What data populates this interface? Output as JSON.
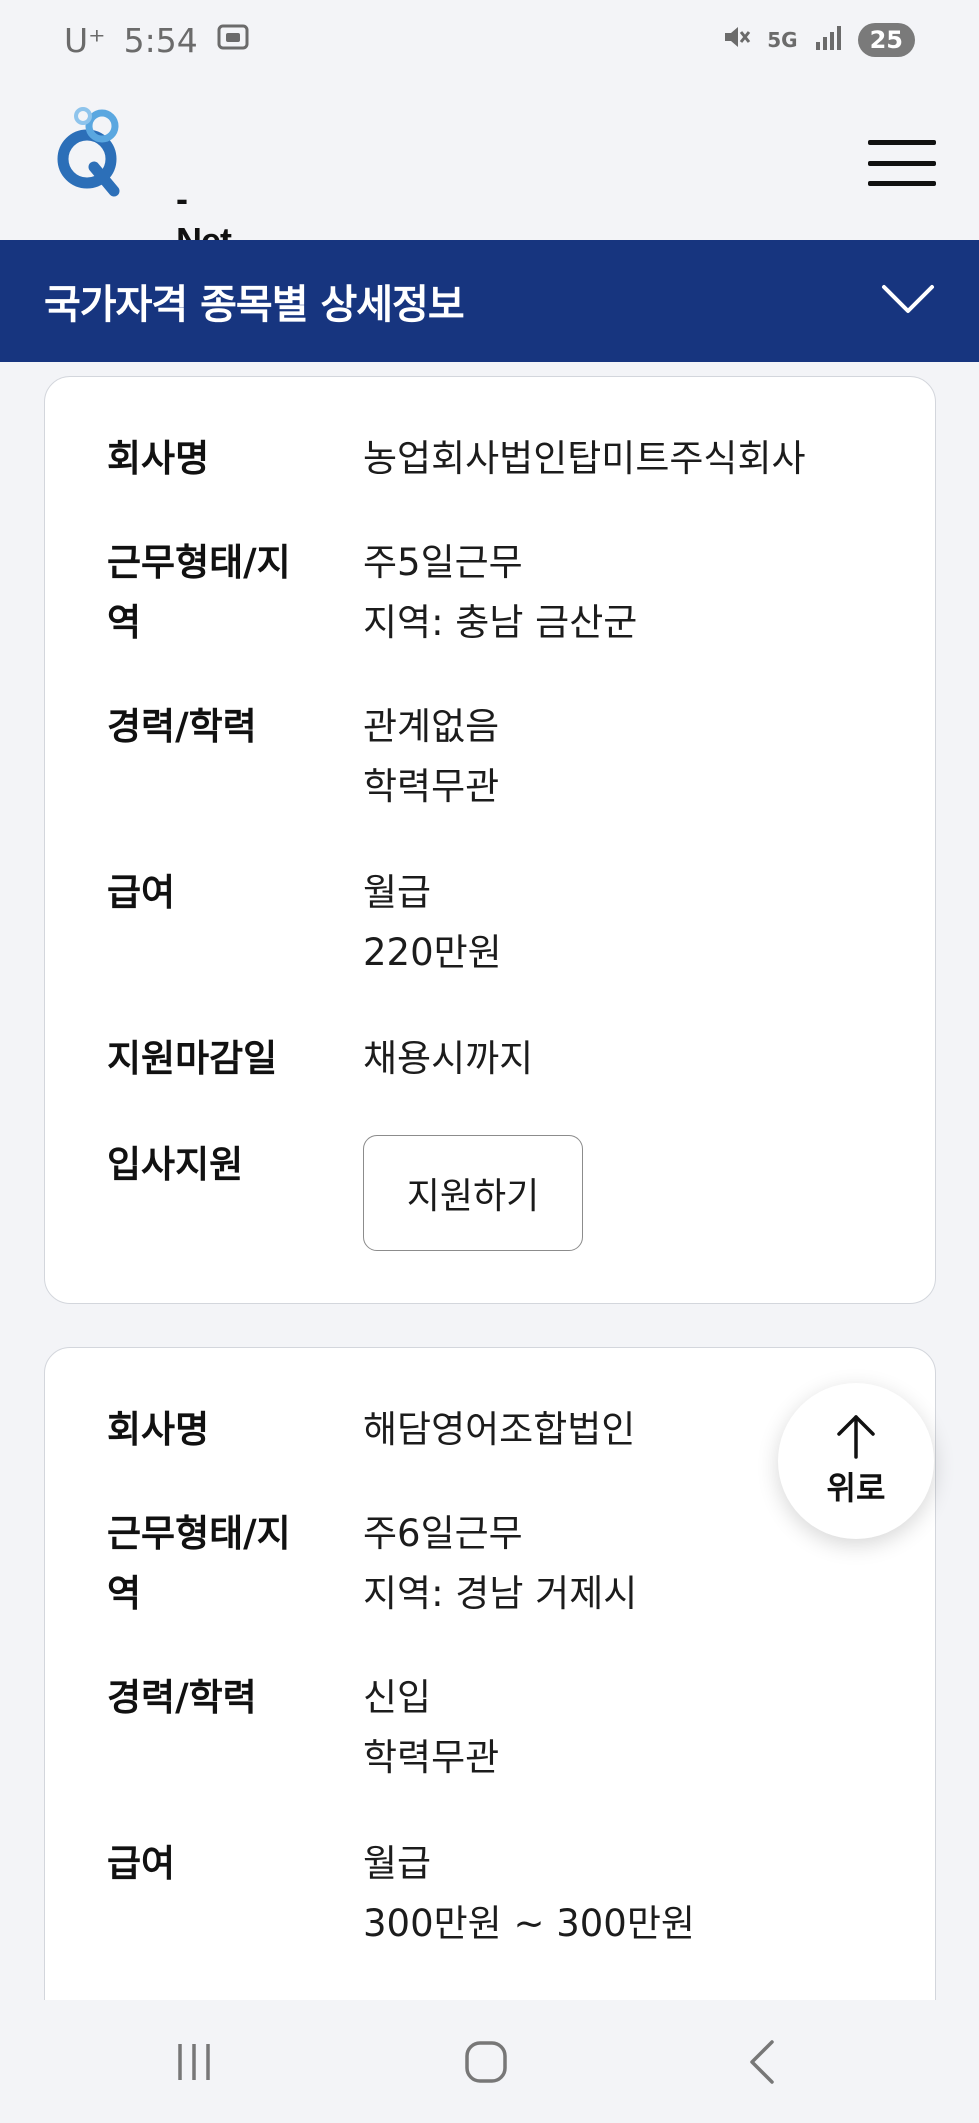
{
  "status_bar": {
    "carrier": "U⁺",
    "time": "5:54",
    "network": "5G",
    "battery": "25"
  },
  "header": {
    "logo_text": "- Net"
  },
  "title_bar": {
    "title": "국가자격 종목별 상세정보"
  },
  "labels": {
    "company": "회사명",
    "work_type_region_line1": "근무형태/지",
    "work_type_region_line2": "역",
    "career_education": "경력/학력",
    "salary": "급여",
    "deadline": "지원마감일",
    "apply": "입사지원"
  },
  "jobs": [
    {
      "company": "농업회사법인탑미트주식회사",
      "work_type": "주5일근무",
      "region": "지역: 충남 금산군",
      "career": "관계없음",
      "education": "학력무관",
      "salary_type": "월급",
      "salary": "220만원",
      "deadline": "채용시까지",
      "apply_button": "지원하기"
    },
    {
      "company": "해담영어조합법인",
      "work_type": "주6일근무",
      "region": "지역: 경남 거제시",
      "career": "신입",
      "education": "학력무관",
      "salary_type": "월급",
      "salary": "300만원 ~ 300만원"
    }
  ],
  "scroll_top": {
    "label": "위로"
  }
}
